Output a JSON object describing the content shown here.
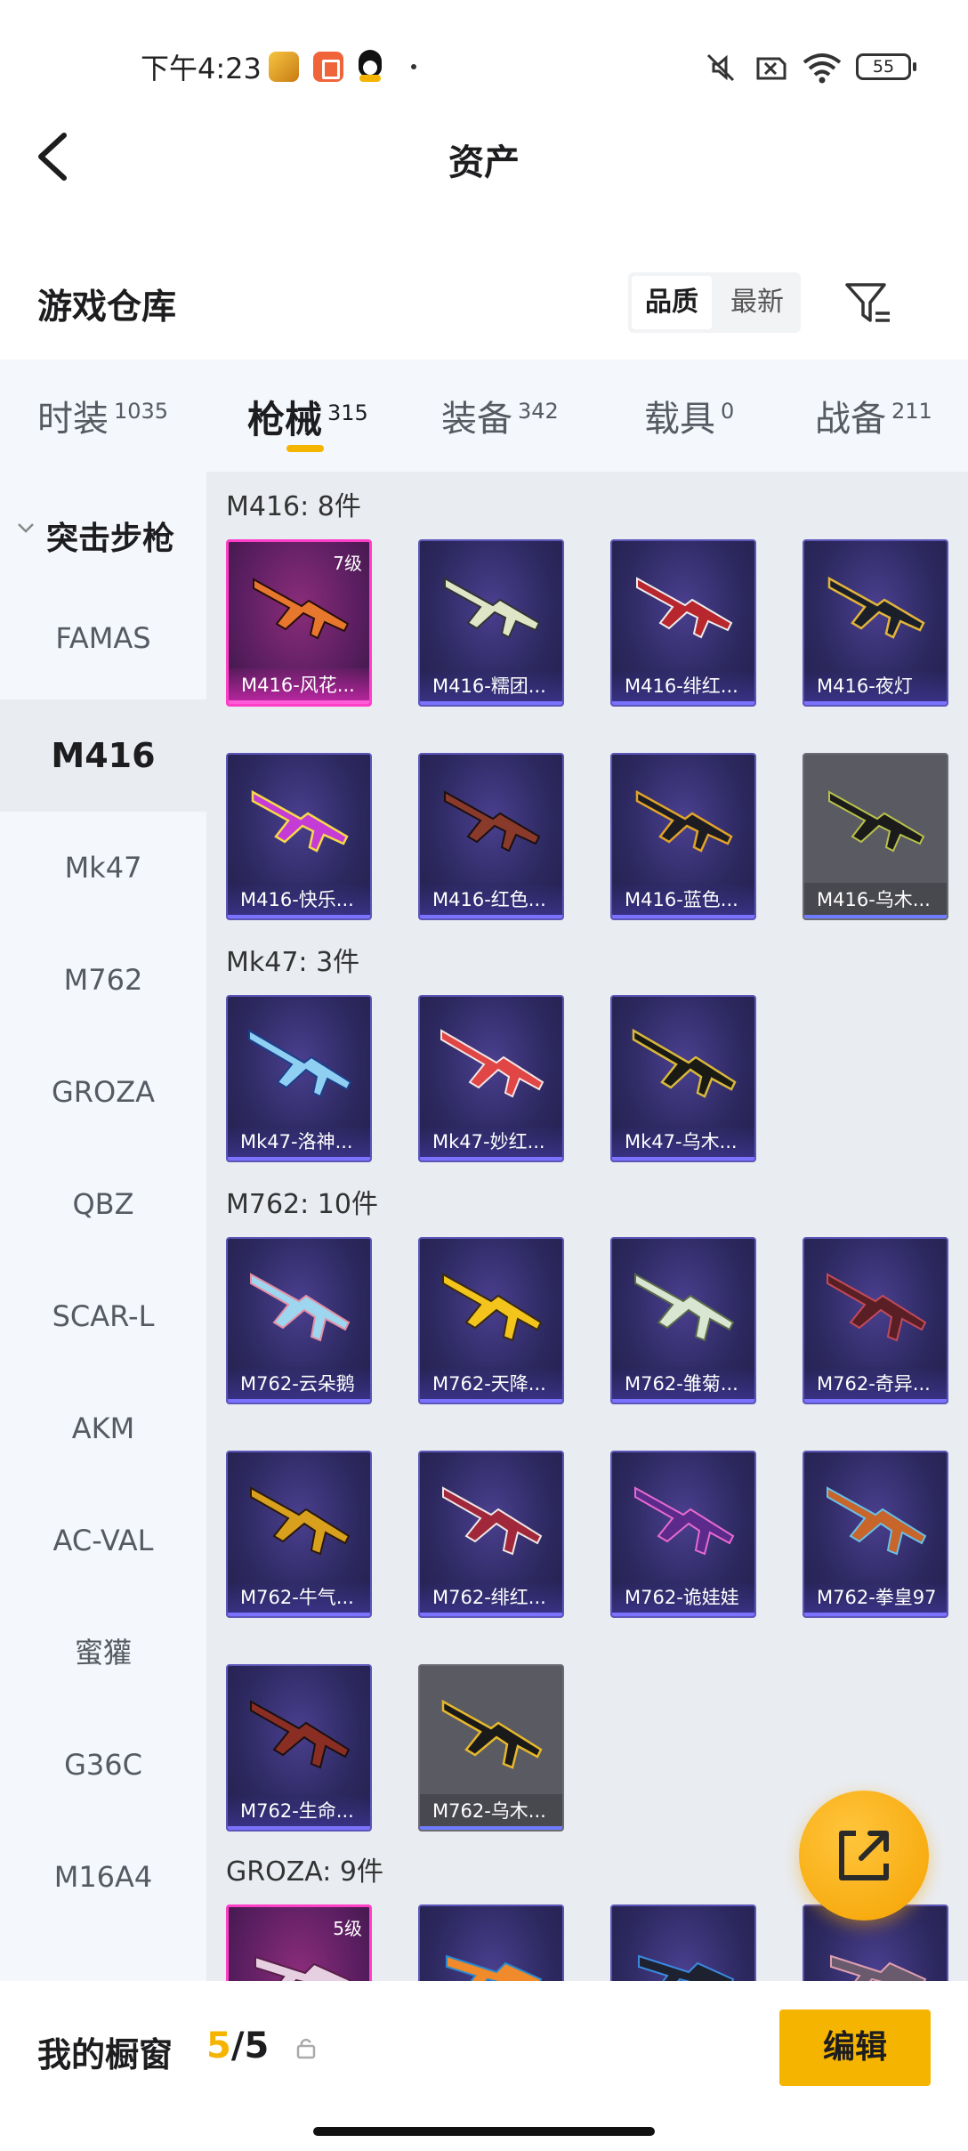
{
  "status_bar": {
    "time": "下午4:23",
    "battery": "55"
  },
  "header": {
    "title": "资产"
  },
  "warehouse": {
    "title": "游戏仓库",
    "sort_quality": "品质",
    "sort_newest": "最新"
  },
  "tabs": [
    {
      "label": "时装",
      "count": "1035"
    },
    {
      "label": "枪械",
      "count": "315"
    },
    {
      "label": "装备",
      "count": "342"
    },
    {
      "label": "载具",
      "count": "0"
    },
    {
      "label": "战备",
      "count": "211"
    }
  ],
  "side_nav": {
    "group": "突击步枪",
    "items": [
      "FAMAS",
      "M416",
      "Mk47",
      "M762",
      "GROZA",
      "QBZ",
      "SCAR-L",
      "AKM",
      "AC-VAL",
      "蜜獾",
      "G36C",
      "M16A4"
    ]
  },
  "sections": {
    "m416": {
      "header": "M416: 8件",
      "items": [
        {
          "name": "M416-风花...",
          "level": "7级"
        },
        {
          "name": "M416-糯团..."
        },
        {
          "name": "M416-绯红..."
        },
        {
          "name": "M416-夜灯"
        },
        {
          "name": "M416-快乐..."
        },
        {
          "name": "M416-红色..."
        },
        {
          "name": "M416-蓝色..."
        },
        {
          "name": "M416-乌木..."
        }
      ]
    },
    "mk47": {
      "header": "Mk47: 3件",
      "items": [
        {
          "name": "Mk47-洛神..."
        },
        {
          "name": "Mk47-妙红..."
        },
        {
          "name": "Mk47-乌木..."
        }
      ]
    },
    "m762": {
      "header": "M762: 10件",
      "items": [
        {
          "name": "M762-云朵鹅"
        },
        {
          "name": "M762-天降..."
        },
        {
          "name": "M762-雏菊..."
        },
        {
          "name": "M762-奇异..."
        },
        {
          "name": "M762-牛气..."
        },
        {
          "name": "M762-绯红..."
        },
        {
          "name": "M762-诡娃娃"
        },
        {
          "name": "M762-拳皇97"
        },
        {
          "name": "M762-生命..."
        },
        {
          "name": "M762-乌木..."
        }
      ]
    },
    "groza": {
      "header": "GROZA: 9件",
      "items": [
        {
          "level": "5级"
        }
      ]
    }
  },
  "bottom_bar": {
    "showcase_label": "我的橱窗",
    "showcase_used": "5",
    "showcase_total": "/5",
    "edit_label": "编辑"
  },
  "colors": {
    "accent": "#f5b400",
    "legendary_border": "#ff3ec8",
    "card_bg": "#2e2a62",
    "sidebar_bg": "#f4f7fb",
    "content_bg": "#e9ecf1"
  },
  "icons": {
    "back": "chevron-left-icon",
    "filter": "filter-icon",
    "collapse": "chevron-down-icon",
    "share": "share-out-icon",
    "lock": "lock-icon"
  }
}
